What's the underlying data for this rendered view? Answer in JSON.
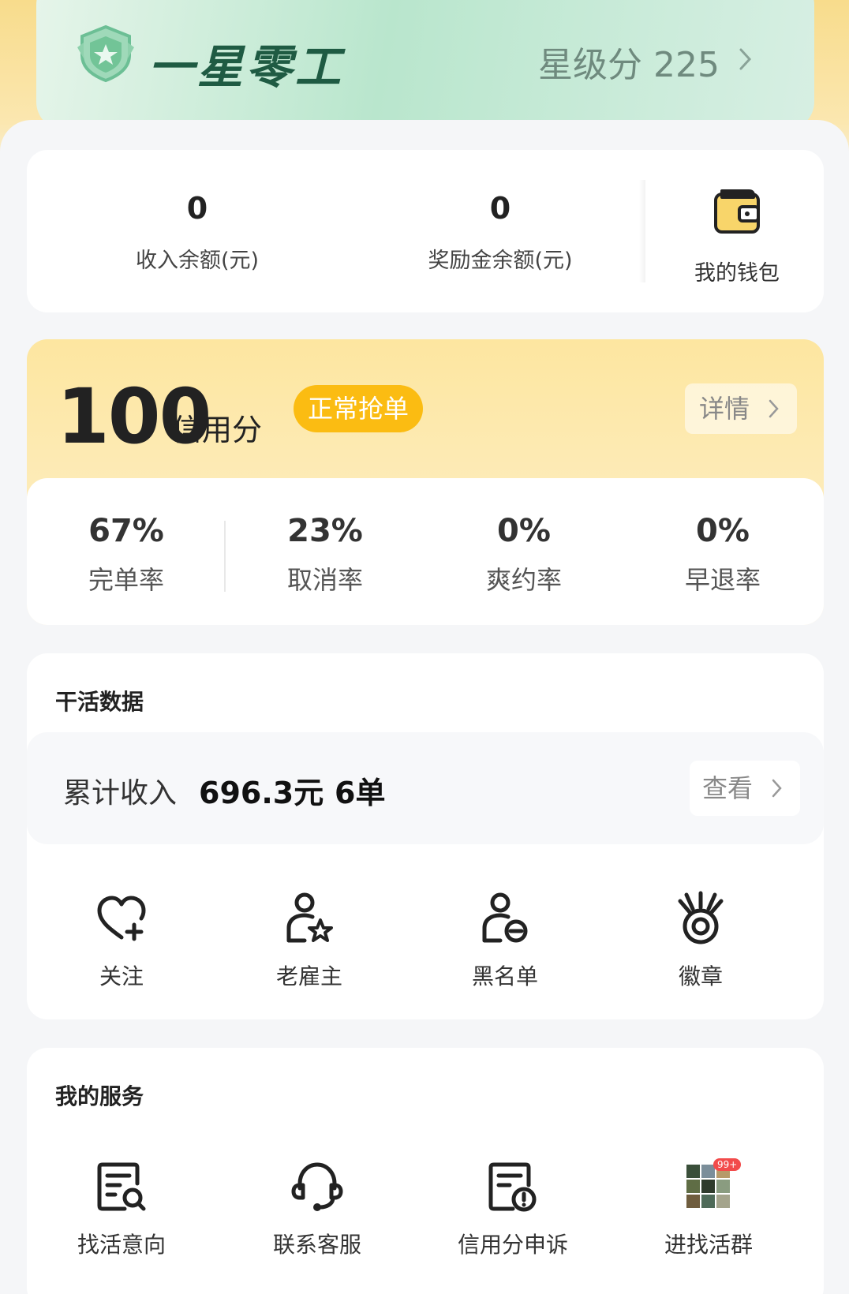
{
  "level": {
    "name": "一星零工",
    "star_score_text": "星级分 225"
  },
  "wallet": {
    "income_balance": "0",
    "income_balance_label": "收入余额(元)",
    "bonus_balance": "0",
    "bonus_balance_label": "奖励金余额(元)",
    "my_wallet_label": "我的钱包"
  },
  "credit": {
    "score": "100",
    "unit": "信用分",
    "status": "正常抢单",
    "detail_label": "详情",
    "rates": [
      {
        "value": "67%",
        "label": "完单率"
      },
      {
        "value": "23%",
        "label": "取消率"
      },
      {
        "value": "0%",
        "label": "爽约率"
      },
      {
        "value": "0%",
        "label": "早退率"
      }
    ]
  },
  "work": {
    "title": "干活数据",
    "income_label": "累计收入",
    "income_value": "696.3元",
    "orders": "6单",
    "view_label": "查看",
    "items": [
      {
        "label": "关注",
        "icon": "heart-plus-icon"
      },
      {
        "label": "老雇主",
        "icon": "user-star-icon"
      },
      {
        "label": "黑名单",
        "icon": "user-block-icon"
      },
      {
        "label": "徽章",
        "icon": "medal-icon"
      }
    ]
  },
  "services": {
    "title": "我的服务",
    "items": [
      {
        "label": "找活意向",
        "icon": "document-search-icon"
      },
      {
        "label": "联系客服",
        "icon": "headset-icon"
      },
      {
        "label": "信用分申诉",
        "icon": "document-alert-icon"
      },
      {
        "label": "进找活群",
        "icon": "group-thumbnail-icon",
        "badge": "99+"
      }
    ]
  },
  "colors": {
    "accent_yellow": "#fbbc12",
    "level_green": "#1f5b43"
  }
}
